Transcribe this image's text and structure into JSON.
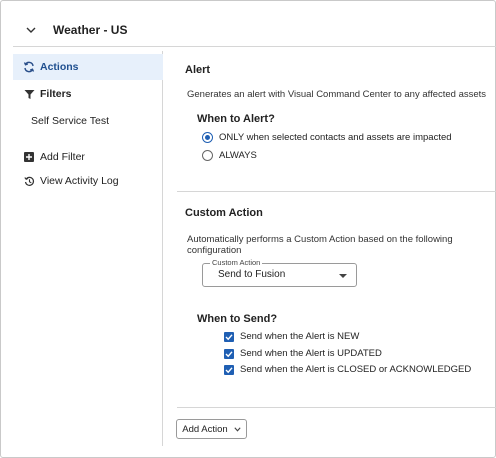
{
  "header": {
    "title": "Weather - US",
    "collapse_icon": "chevron-down-icon"
  },
  "sidebar": {
    "items": [
      {
        "label": "Actions",
        "icon": "refresh-actions-icon",
        "active": true
      },
      {
        "label": "Filters",
        "icon": "filter-icon"
      },
      {
        "label": "Self Service Test"
      },
      {
        "label": "Add Filter",
        "icon": "plus-box-icon"
      },
      {
        "label": "View Activity Log",
        "icon": "history-icon"
      }
    ]
  },
  "alert": {
    "title": "Alert",
    "description": "Generates an alert with Visual Command Center to any affected assets",
    "when_label": "When to Alert?",
    "options": [
      {
        "label": "ONLY when selected contacts and assets are impacted",
        "selected": true
      },
      {
        "label": "ALWAYS",
        "selected": false
      }
    ]
  },
  "custom_action": {
    "title": "Custom Action",
    "description": "Automatically performs a Custom Action based on the following configuration",
    "select_label": "Custom Action",
    "select_value": "Send to Fusion",
    "when_label": "When to Send?",
    "checks": [
      {
        "label": "Send when the Alert is NEW",
        "checked": true
      },
      {
        "label": "Send when the Alert is UPDATED",
        "checked": true
      },
      {
        "label": "Send when the Alert is CLOSED or ACKNOWLEDGED",
        "checked": true
      }
    ]
  },
  "add_action_label": "Add Action",
  "colors": {
    "accent": "#1f5fb3",
    "active_bg": "#e7f0fb",
    "border": "#d6d6d6"
  }
}
